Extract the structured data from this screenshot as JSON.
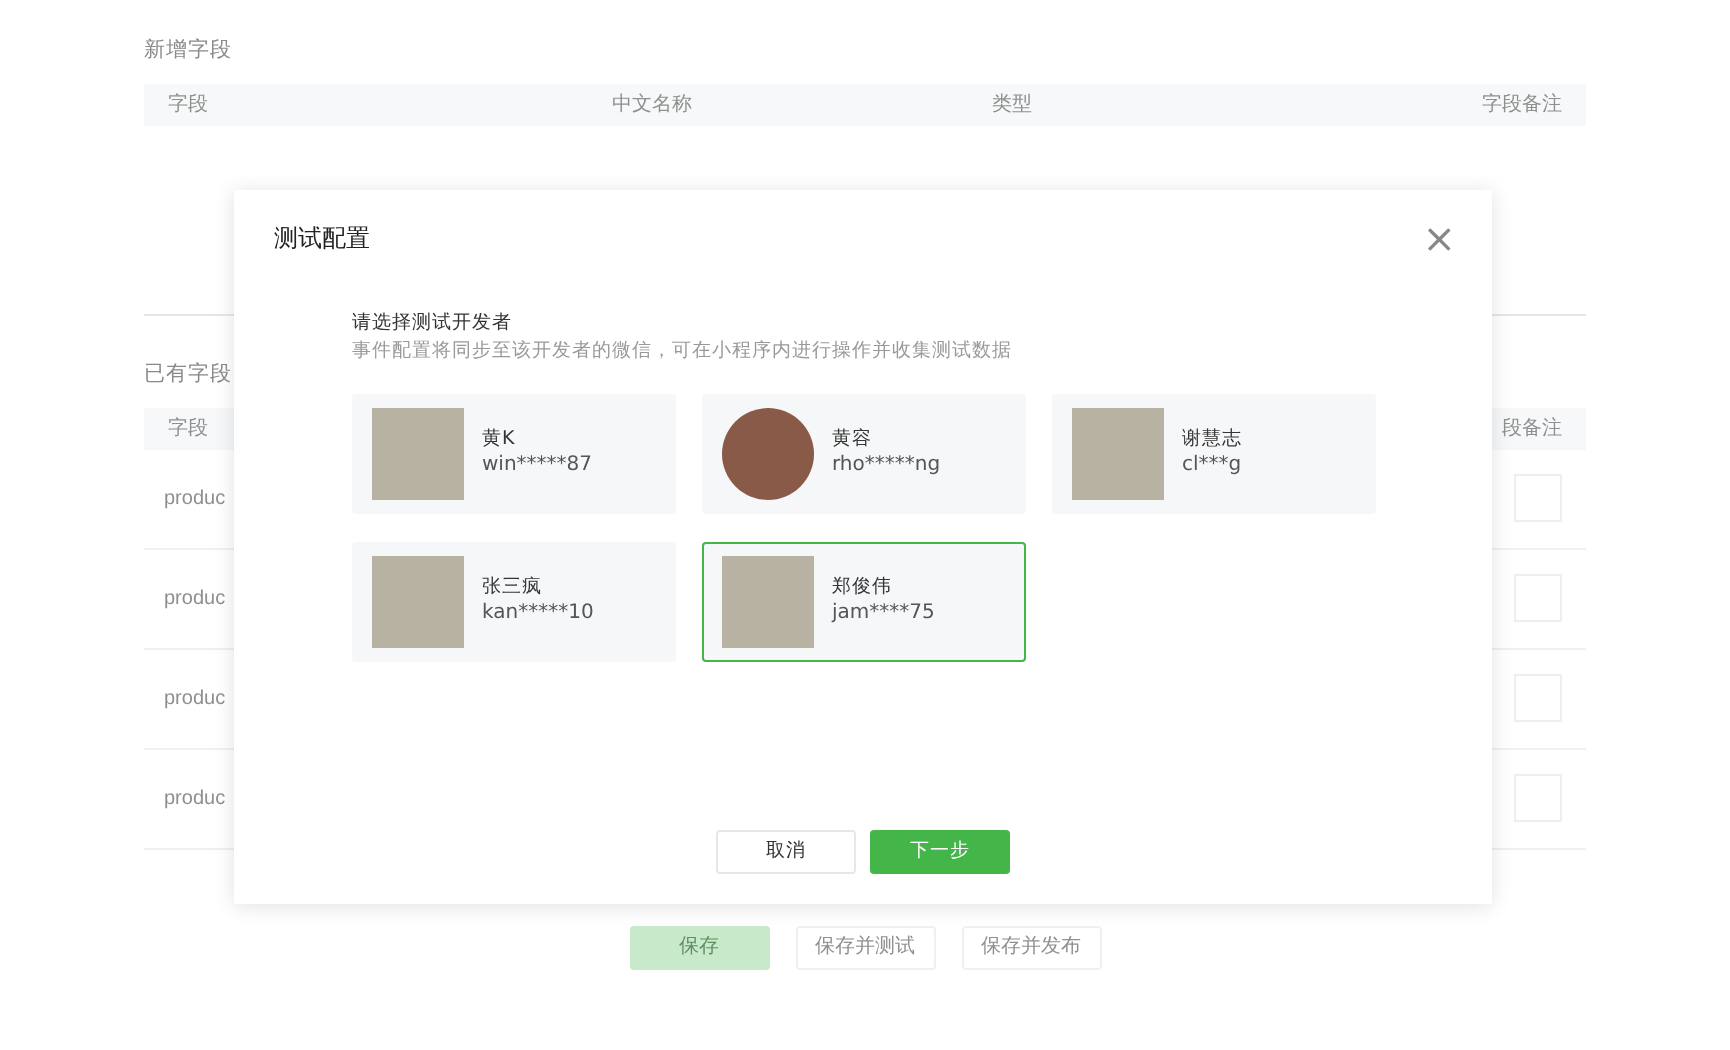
{
  "page": {
    "new_section": {
      "title": "新增字段",
      "columns": [
        "字段",
        "中文名称",
        "类型",
        "字段备注"
      ]
    },
    "existing_section": {
      "title": "已有字段",
      "columns": [
        "字段",
        "段备注"
      ],
      "rows": [
        {
          "field": "produc"
        },
        {
          "field": "produc"
        },
        {
          "field": "produc"
        },
        {
          "field": "produc"
        }
      ]
    },
    "buttons": [
      {
        "label": "保存",
        "kind": "primary"
      },
      {
        "label": "保存并测试",
        "kind": "default"
      },
      {
        "label": "保存并发布",
        "kind": "default"
      }
    ]
  },
  "dialog": {
    "title": "测试配置",
    "close": "×",
    "heading": "请选择测试开发者",
    "description": "事件配置将同步至该开发者的微信，可在小程序内进行操作并收集测试数据",
    "developers": [
      {
        "name": "黄K",
        "account": "win*****87",
        "kind": "square",
        "selected": false
      },
      {
        "name": "黄容",
        "account": "rho*****ng",
        "kind": "round",
        "selected": false
      },
      {
        "name": "谢慧志",
        "account": "cl***g",
        "kind": "square",
        "selected": false
      },
      {
        "name": "张三疯",
        "account": "kan*****10",
        "kind": "square",
        "selected": false
      },
      {
        "name": "郑俊伟",
        "account": "jam****75",
        "kind": "square",
        "selected": true
      }
    ],
    "buttons": [
      {
        "label": "取消",
        "kind": "default"
      },
      {
        "label": "下一步",
        "kind": "primary"
      }
    ]
  }
}
